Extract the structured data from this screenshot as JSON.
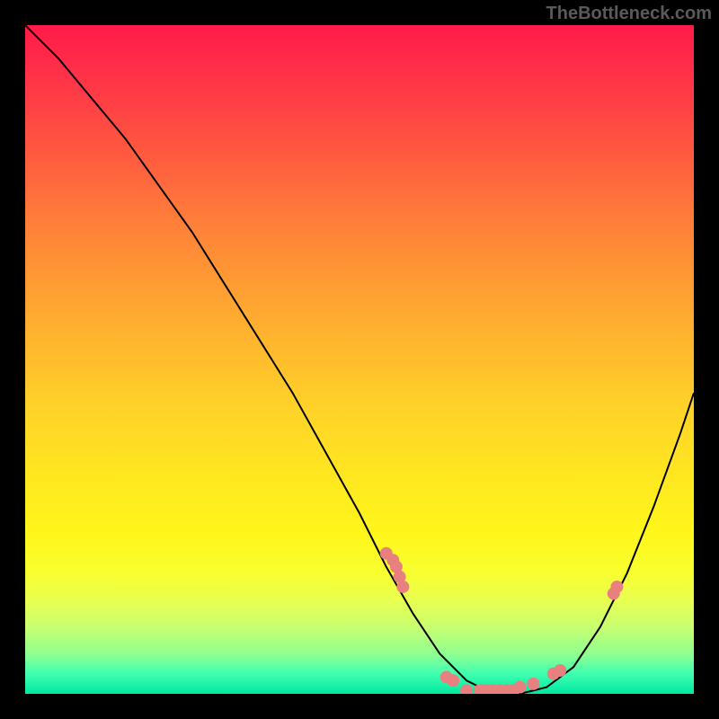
{
  "watermark": "TheBottleneck.com",
  "chart_data": {
    "type": "line",
    "title": "",
    "xlabel": "",
    "ylabel": "",
    "xlim": [
      0,
      100
    ],
    "ylim": [
      0,
      100
    ],
    "curve": {
      "name": "bottleneck-curve",
      "x": [
        0,
        5,
        10,
        15,
        20,
        25,
        30,
        35,
        40,
        45,
        50,
        54,
        58,
        62,
        66,
        70,
        74,
        78,
        82,
        86,
        90,
        94,
        98,
        100
      ],
      "y": [
        100,
        95,
        89,
        83,
        76,
        69,
        61,
        53,
        45,
        36,
        27,
        19,
        12,
        6,
        2,
        0,
        0,
        1,
        4,
        10,
        18,
        28,
        39,
        45
      ]
    },
    "points": {
      "name": "data-points",
      "color": "#e98080",
      "x": [
        54,
        55,
        55.5,
        56,
        56.5,
        63,
        64,
        66,
        68,
        69,
        70,
        71,
        72,
        73,
        74,
        76,
        79,
        80,
        88,
        88.5
      ],
      "y": [
        21,
        20,
        19,
        17.5,
        16,
        2.5,
        2,
        0.5,
        0.5,
        0.5,
        0.5,
        0.5,
        0.5,
        0.5,
        1,
        1.5,
        3,
        3.5,
        15,
        16
      ]
    }
  }
}
